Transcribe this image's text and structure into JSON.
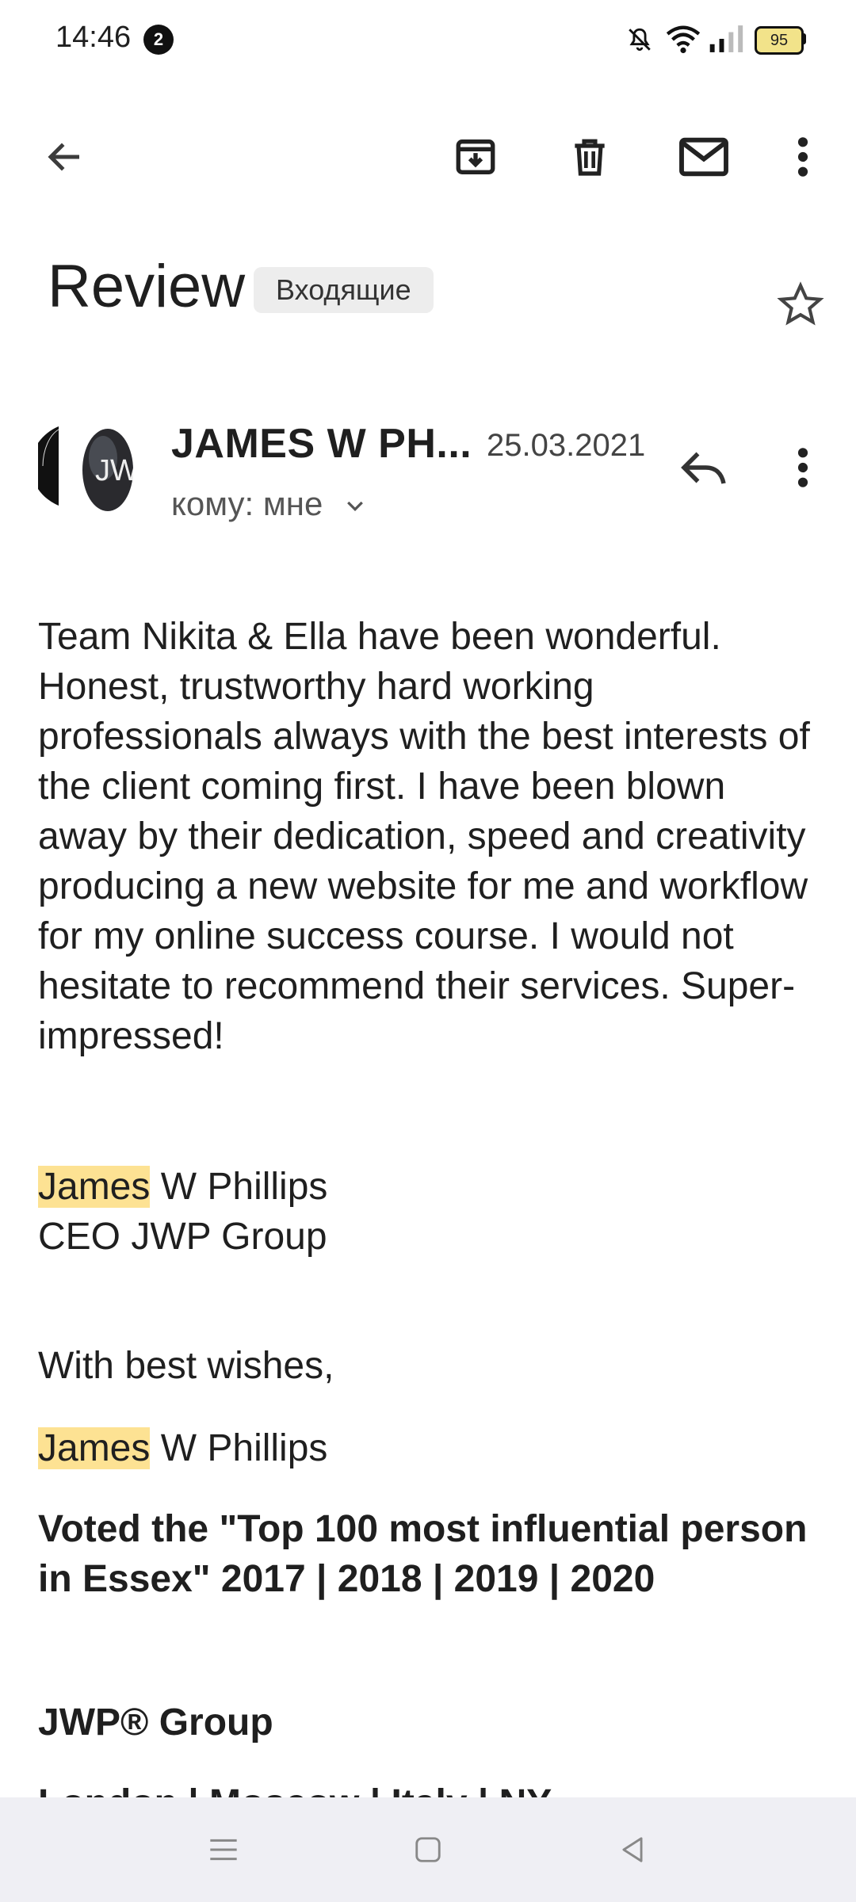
{
  "status_bar": {
    "time": "14:46",
    "notification_count": "2",
    "battery": "95",
    "icons": [
      "bell-off-icon",
      "wifi-icon",
      "signal-icon",
      "battery-icon"
    ]
  },
  "toolbar": {
    "back_icon": "arrow-back-icon",
    "archive_icon": "archive-icon",
    "delete_icon": "trash-icon",
    "mark_unread_icon": "mail-icon",
    "more_icon": "more-vert-icon"
  },
  "email": {
    "subject": "Review",
    "label": "Входящие",
    "star_icon": "star-outline-icon",
    "sender": {
      "name": "JAMES W PH...",
      "date": "25.03.2021",
      "avatar_text": "JW",
      "to_line": "кому: мне",
      "reply_icon": "reply-icon",
      "more_icon": "more-vert-icon",
      "expand_icon": "chevron-down-icon"
    },
    "body": "Team Nikita & Ella have been wonderful. Honest, trustworthy hard working professionals always with the best interests of the client coming first. I have been blown away by their dedication, speed and creativity producing a new website for me and workflow for my online success course. I would not hesitate to recommend their services. Super-impressed!",
    "signature_1": {
      "highlight": "James",
      "rest": " W Phillips",
      "title": "CEO JWP Group"
    },
    "closing": "With best wishes,",
    "signature_2": {
      "highlight": "James",
      "rest": " W Phillips"
    },
    "voted": "Voted the \"Top 100 most influential person in Essex\" 2017 | 2018 | 2019 | 2020",
    "company": "JWP® Group",
    "locations_partial": "London | Moscow | Italy | NY"
  },
  "nav_bar": {
    "icons": [
      "menu-icon",
      "home-square-icon",
      "back-triangle-icon"
    ]
  },
  "colors": {
    "highlight": "#fde293",
    "chip_bg": "#ededed",
    "battery_fill": "#f2e38a",
    "navbar_bg": "#efeff4"
  }
}
